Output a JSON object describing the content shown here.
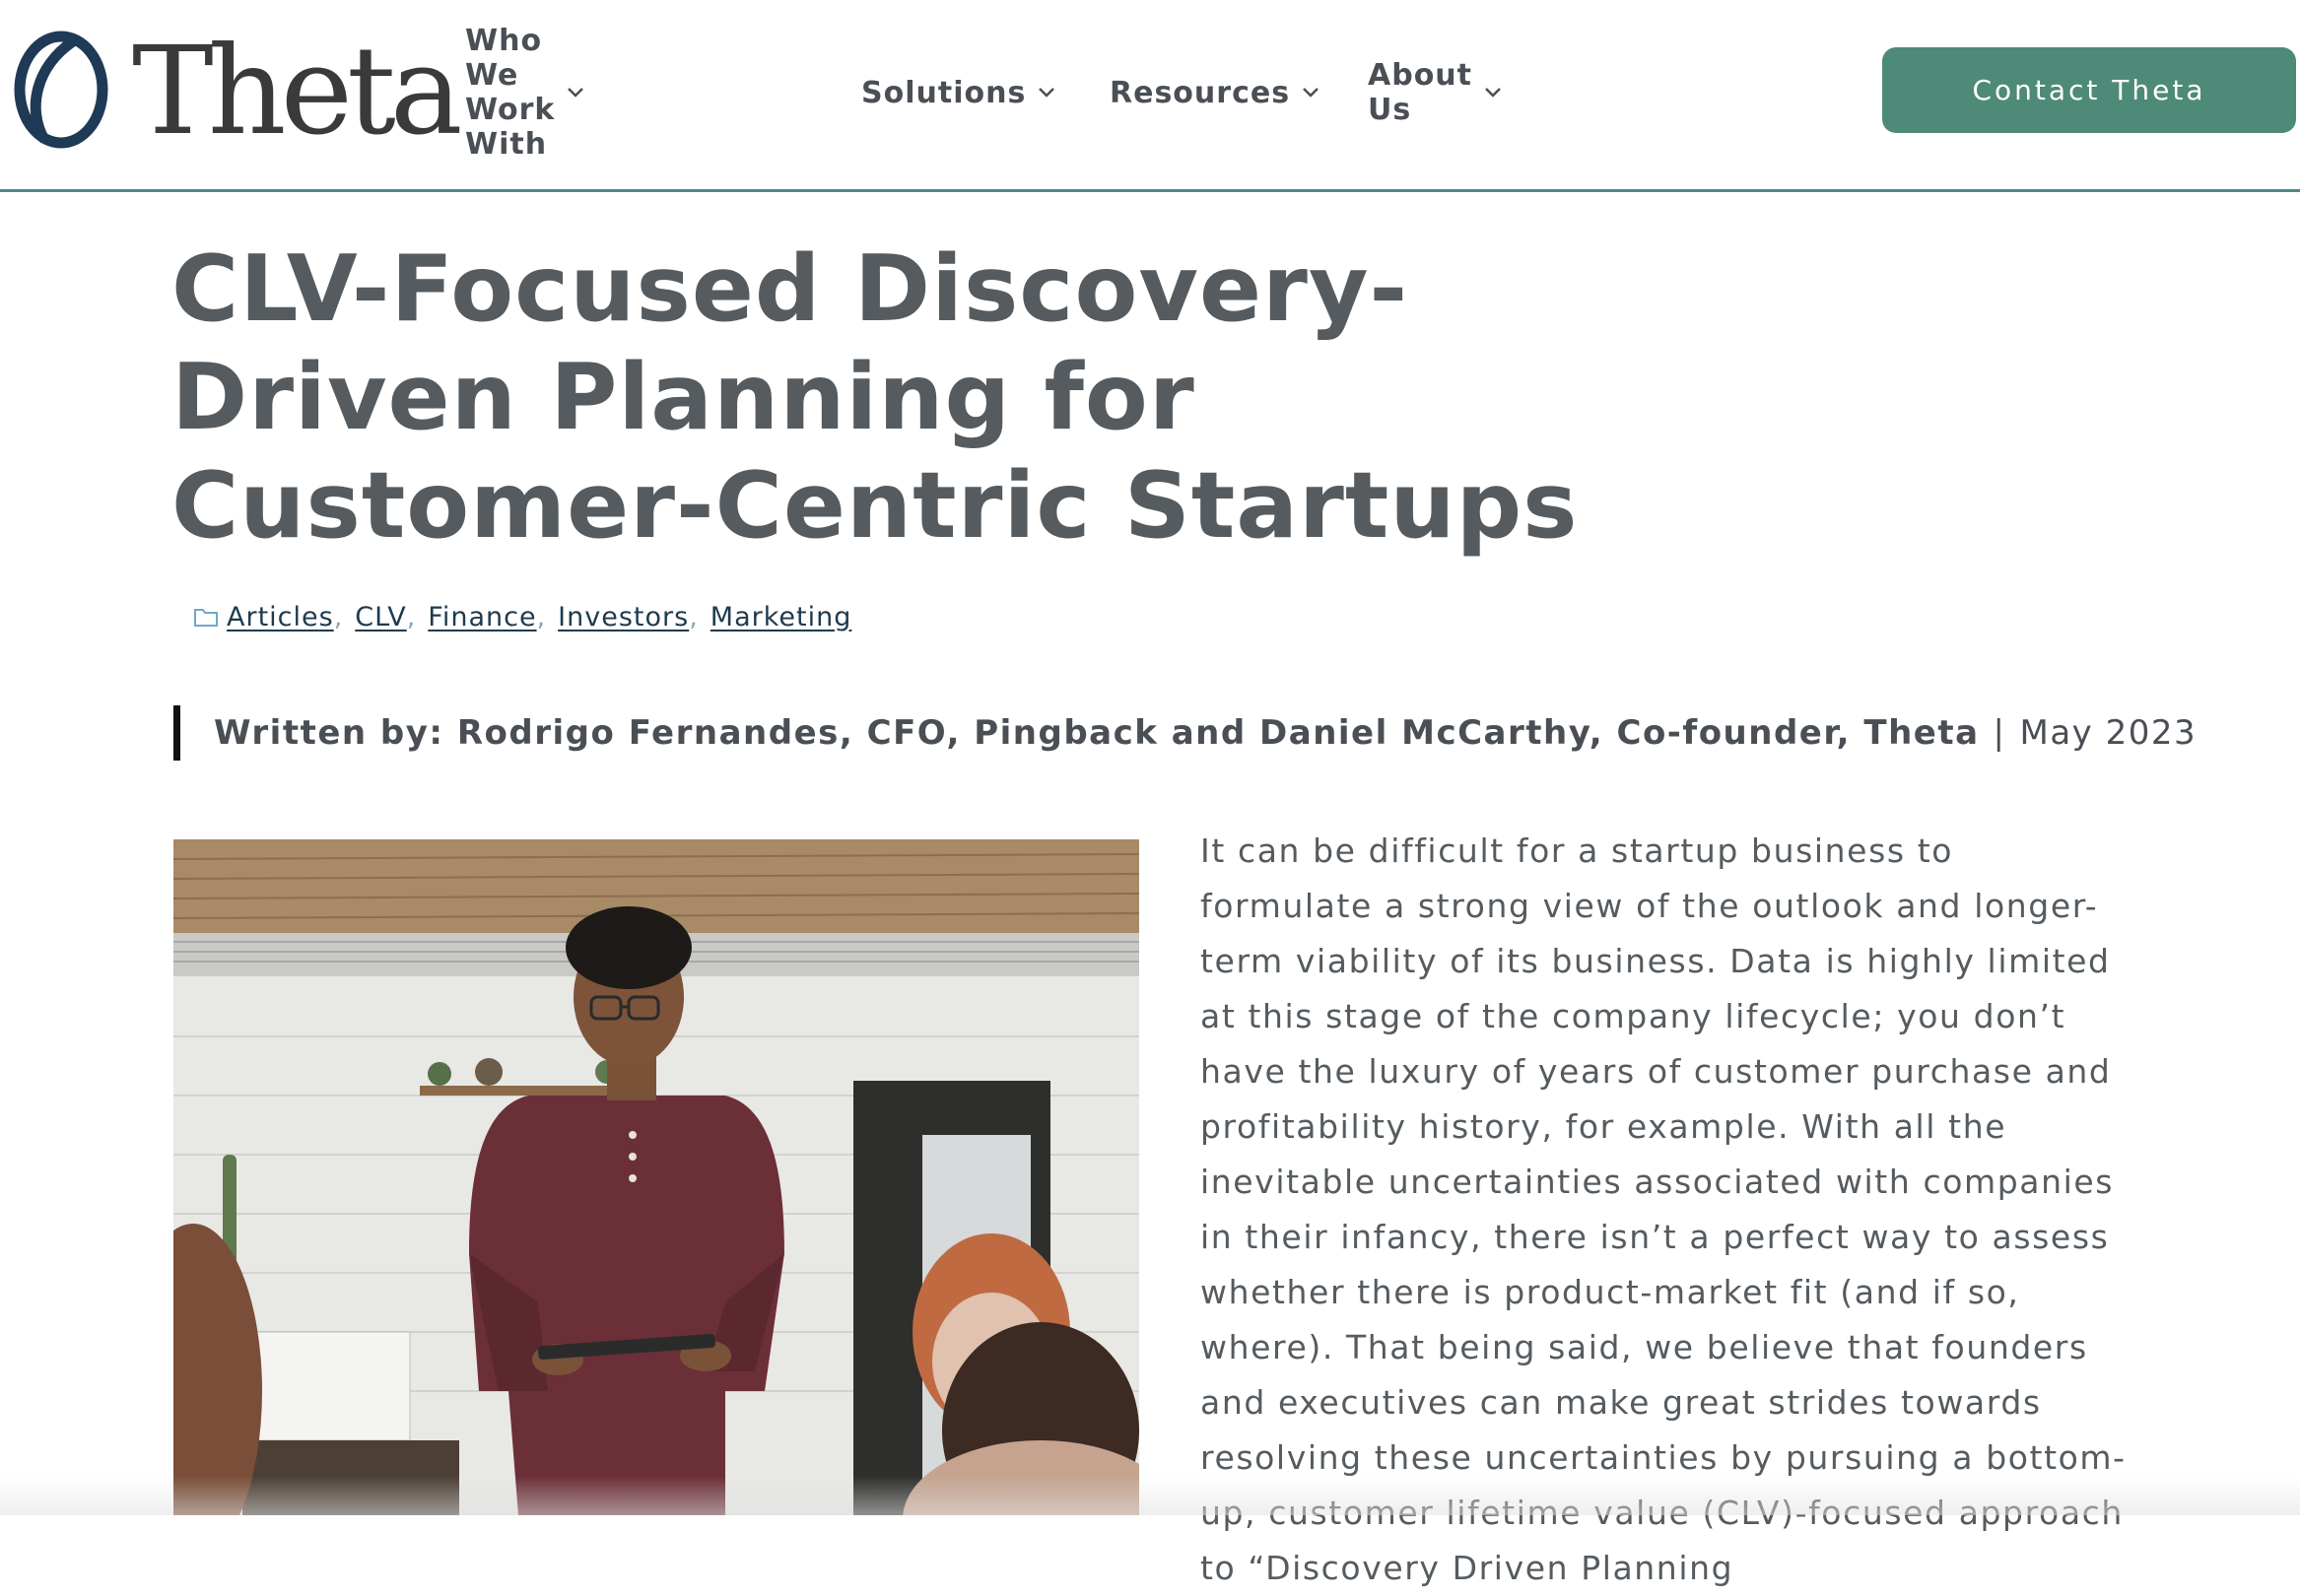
{
  "header": {
    "brand": "Theta",
    "nav": [
      {
        "label": "Who We Work With"
      },
      {
        "label": "Solutions"
      },
      {
        "label": "Resources"
      },
      {
        "label": "About Us"
      }
    ],
    "cta_label": "Contact Theta",
    "accent_color": "#4d8a77"
  },
  "article": {
    "title": "CLV-Focused Discovery-Driven Planning for Customer-Centric Startups",
    "categories": [
      "Articles",
      "CLV",
      "Finance",
      "Investors",
      "Marketing"
    ],
    "byline_authors": "Written by: Rodrigo Fernandes, CFO, Pingback and Daniel McCarthy, Co-founder, Theta",
    "byline_separator": "|",
    "byline_date": "May 2023",
    "body": "It can be difficult for a startup business to formulate a strong view of the outlook and longer-term viability of its business. Data is highly limited at this stage of the company lifecycle; you don’t have the luxury of years of customer purchase and profitability history, for example. With all the inevitable uncertainties associated with companies in their infancy, there isn’t a perfect way to assess whether there is product-market fit (and if so, where). That being said, we believe that founders and executives can make great strides towards resolving these uncertainties by pursuing a bottom-up, customer lifetime value (CLV)-focused approach to “Discovery Driven Planning"
  },
  "icons": {
    "logo": "theta-logo-mark",
    "nav_chevron": "chevron-down-icon",
    "categories": "folder-icon"
  }
}
